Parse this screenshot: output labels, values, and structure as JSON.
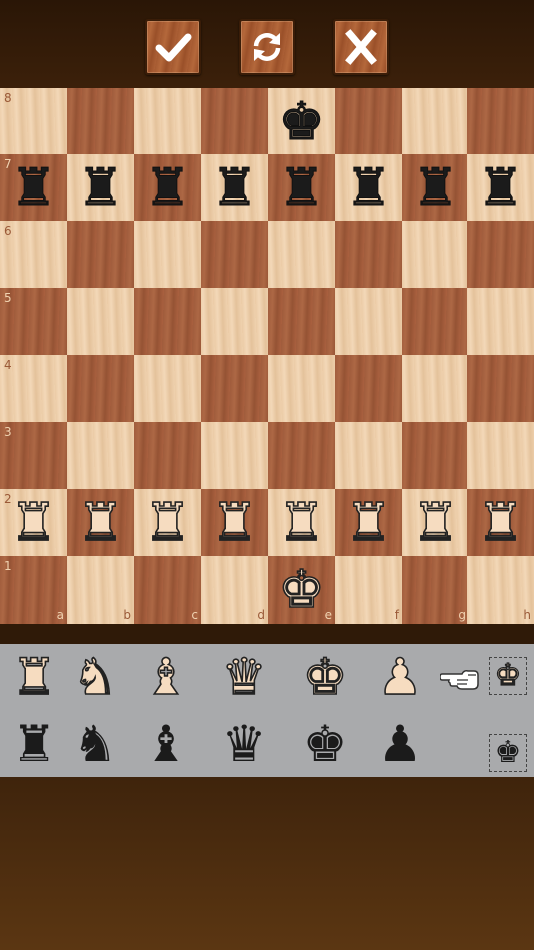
{
  "toolbar": {
    "buttons": [
      {
        "name": "confirm-button",
        "icon": "check-icon"
      },
      {
        "name": "flip-board-button",
        "icon": "rotate-icon"
      },
      {
        "name": "close-button",
        "icon": "x-icon"
      }
    ]
  },
  "board": {
    "ranks": [
      "8",
      "7",
      "6",
      "5",
      "4",
      "3",
      "2",
      "1"
    ],
    "files": [
      "a",
      "b",
      "c",
      "d",
      "e",
      "f",
      "g",
      "h"
    ],
    "position": [
      [
        "",
        "",
        "",
        "",
        "bK",
        "",
        "",
        ""
      ],
      [
        "bR",
        "bR",
        "bR",
        "bR",
        "bR",
        "bR",
        "bR",
        "bR"
      ],
      [
        "",
        "",
        "",
        "",
        "",
        "",
        "",
        ""
      ],
      [
        "",
        "",
        "",
        "",
        "",
        "",
        "",
        ""
      ],
      [
        "",
        "",
        "",
        "",
        "",
        "",
        "",
        ""
      ],
      [
        "",
        "",
        "",
        "",
        "",
        "",
        "",
        ""
      ],
      [
        "wR",
        "wR",
        "wR",
        "wR",
        "wR",
        "wR",
        "wR",
        "wR"
      ],
      [
        "",
        "",
        "",
        "",
        "wK",
        "",
        "",
        ""
      ]
    ]
  },
  "palette": {
    "white_pieces": [
      "wR",
      "wN",
      "wB",
      "wQ",
      "wK",
      "wP"
    ],
    "black_pieces": [
      "bR",
      "bN",
      "bB",
      "bQ",
      "bK",
      "bP"
    ],
    "pointer_icon": "pointing-hand-icon",
    "selected_side": "white"
  },
  "glyphs": {
    "K": "♚",
    "Q": "♛",
    "R": "♜",
    "B": "♝",
    "N": "♞",
    "P": "♟"
  },
  "piece_names": {
    "K": "king",
    "Q": "queen",
    "R": "rook",
    "B": "bishop",
    "N": "knight",
    "P": "pawn"
  }
}
